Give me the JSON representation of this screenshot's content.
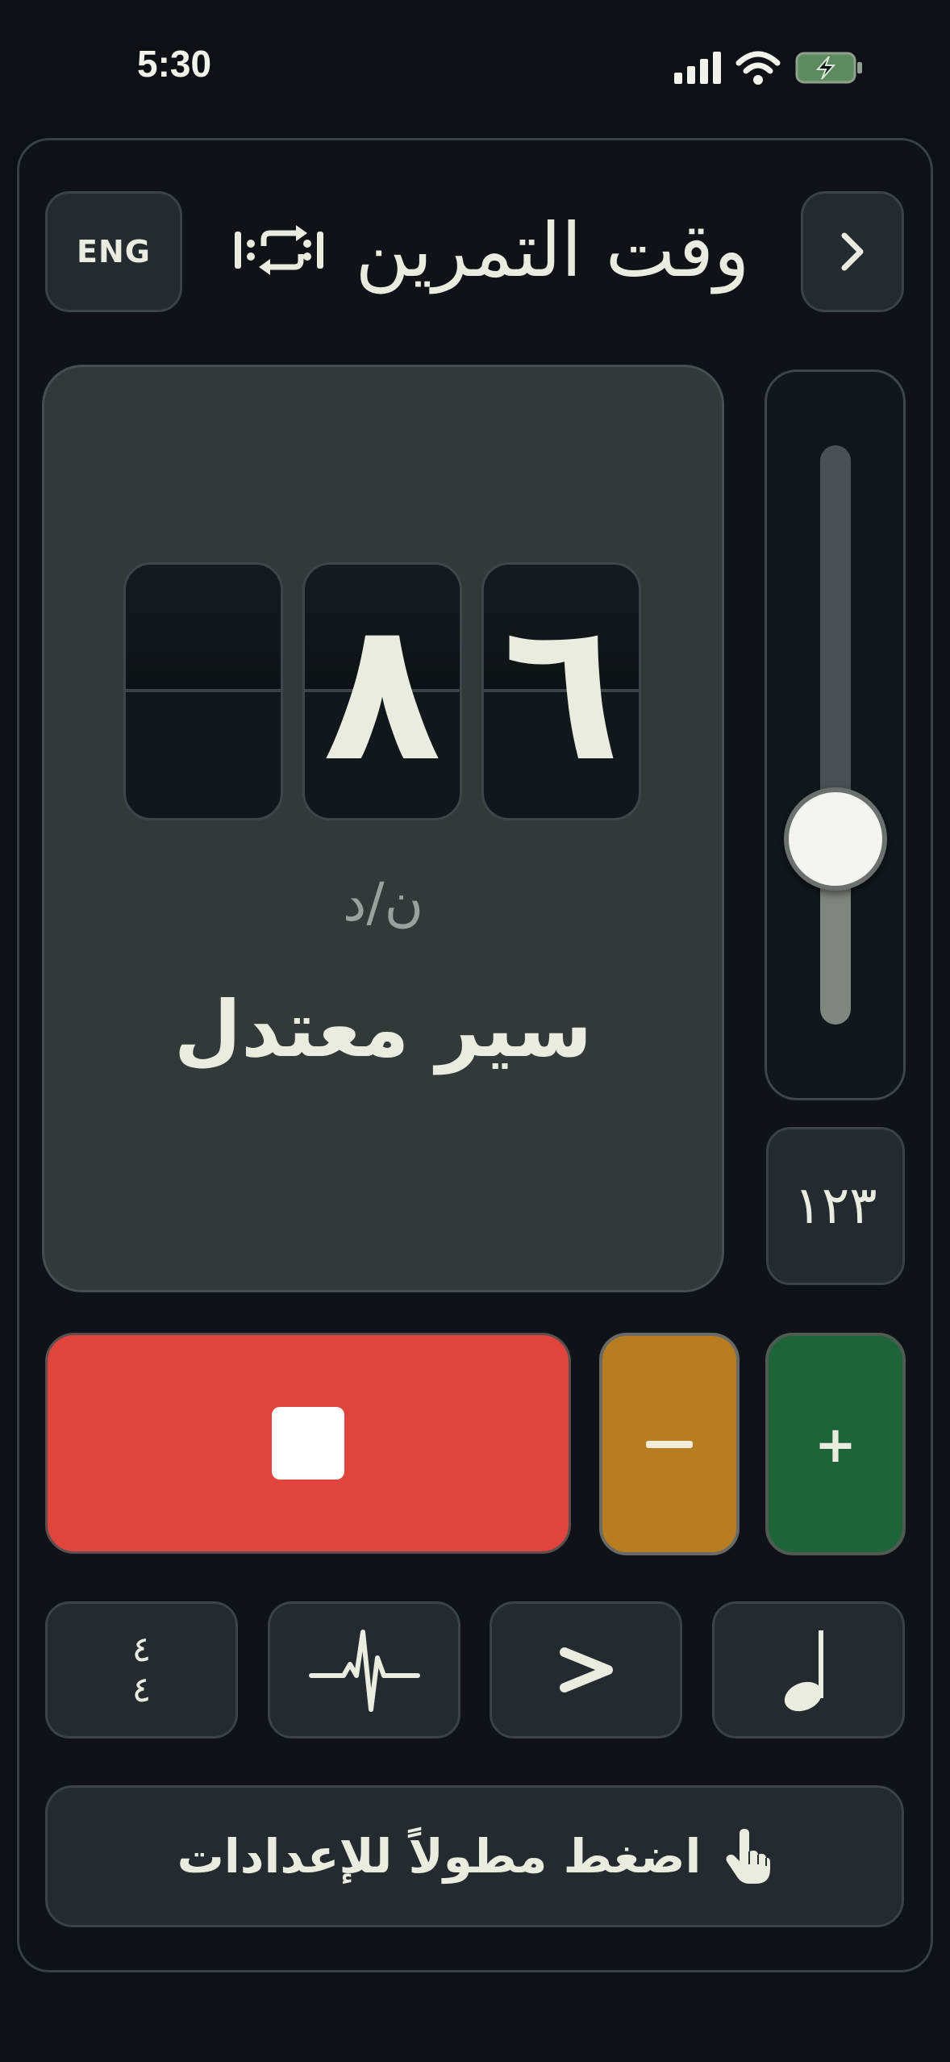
{
  "status_bar": {
    "time": "5:30"
  },
  "header": {
    "language_label": "ENG",
    "title": "وقت التمرين",
    "title_icon": "repeat-loop-icon",
    "next_icon": "chevron-right-icon"
  },
  "tempo": {
    "digits": [
      "",
      "٨",
      "٦"
    ],
    "unit": "ن/د",
    "name": "سير معتدل"
  },
  "slider": {
    "level_fraction": 0.32
  },
  "number_button": {
    "label": "١٢٣"
  },
  "controls": {
    "stop_icon": "stop-icon",
    "decrease_icon": "minus-icon",
    "increase_label": "+"
  },
  "tools": {
    "time_signature": {
      "top": "٤",
      "bottom": "٤"
    },
    "pulse_icon": "heartbeat-icon",
    "accent_icon": "accent-icon",
    "note_icon": "half-note-icon"
  },
  "hint": {
    "text": "اضغط مطولاً للإعدادات",
    "icon": "tap-hand-icon"
  },
  "colors": {
    "background": "#0d1115",
    "stop": "#e0443d",
    "minus": "#b87d20",
    "plus": "#1f6338"
  }
}
